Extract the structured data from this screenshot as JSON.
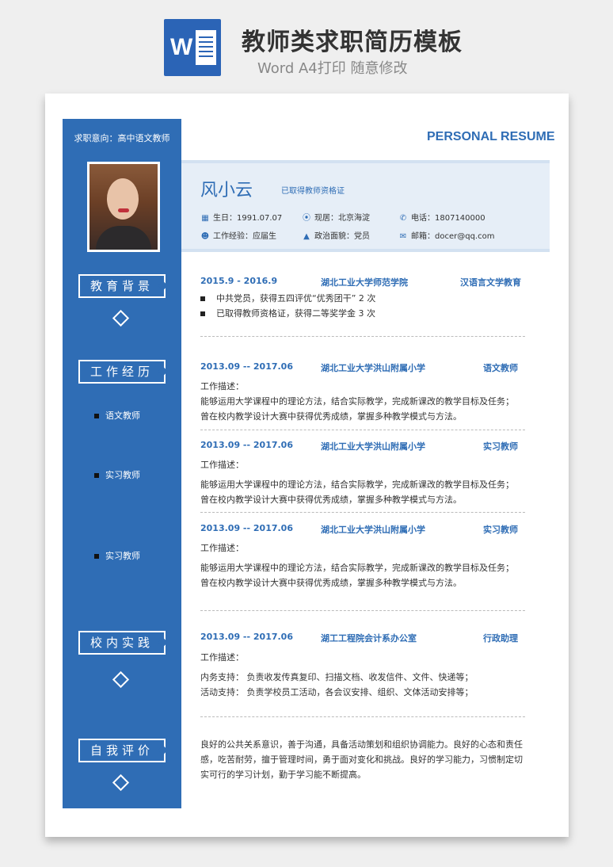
{
  "header": {
    "icon_letter": "W",
    "title": "教师类求职简历模板",
    "subtitle": "Word A4打印 随意修改"
  },
  "resume": {
    "heading": "PERSONAL RESUME",
    "intent": "求职意向：高中语文教师",
    "name": "风小云",
    "certificate": "已取得教师资格证",
    "info": {
      "birth": "生日：1991.07.07",
      "residence": "现居：北京海淀",
      "phone": "电话：1807140000",
      "experience": "工作经验：应届生",
      "politics": "政治面貌：党员",
      "email": "邮箱：docer@qq.com"
    },
    "icons": [
      "calendar-icon",
      "location-icon",
      "phone-icon",
      "person-icon",
      "graduation-cap-icon",
      "envelope-icon"
    ],
    "accent_color": "#2f6db5"
  },
  "sections": {
    "education": {
      "label": "教育背景",
      "date": "2015.9 - 2016.9",
      "school": "湖北工业大学师范学院",
      "major": "汉语言文学教育",
      "bullets": [
        "中共党员，获得五四评优“优秀团干” 2 次",
        "已取得教师资格证，获得二等奖学金 3 次"
      ]
    },
    "work": {
      "label": "工作经历",
      "side_items": [
        "语文教师",
        "实习教师",
        "实习教师"
      ],
      "entries": [
        {
          "date": "2013.09 -- 2017.06",
          "org": "湖北工业大学洪山附属小学",
          "role": "语文教师",
          "desc_label": "工作描述：",
          "lines": [
            "能够运用大学课程中的理论方法，结合实际教学，完成新课改的教学目标及任务；",
            "曾在校内教学设计大赛中获得优秀成绩，掌握多种教学模式与方法。"
          ]
        },
        {
          "date": "2013.09 -- 2017.06",
          "org": "湖北工业大学洪山附属小学",
          "role": "实习教师",
          "desc_label": "工作描述：",
          "lines": [
            "能够运用大学课程中的理论方法，结合实际教学，完成新课改的教学目标及任务；",
            "曾在校内教学设计大赛中获得优秀成绩，掌握多种教学模式与方法。"
          ]
        },
        {
          "date": "2013.09 -- 2017.06",
          "org": "湖北工业大学洪山附属小学",
          "role": "实习教师",
          "desc_label": "工作描述：",
          "lines": [
            "能够运用大学课程中的理论方法，结合实际教学，完成新课改的教学目标及任务；",
            "曾在校内教学设计大赛中获得优秀成绩，掌握多种教学模式与方法。"
          ]
        }
      ]
    },
    "campus": {
      "label": "校内实践",
      "date": "2013.09 -- 2017.06",
      "org": "湖工工程院会计系办公室",
      "role": "行政助理",
      "desc_label": "工作描述：",
      "lines": [
        "内务支持：  负责收发传真复印、扫描文档、收发信件、文件、快递等；",
        "活动支持：  负责学校员工活动，各会议安排、组织、文体活动安排等；"
      ]
    },
    "self": {
      "label": "自我评价",
      "text": "良好的公共关系意识，善于沟通，具备活动策划和组织协调能力。良好的心态和责任感，吃苦耐劳，擅于管理时间，勇于面对变化和挑战。良好的学习能力，习惯制定切实可行的学习计划，勤于学习能不断提高。"
    }
  }
}
